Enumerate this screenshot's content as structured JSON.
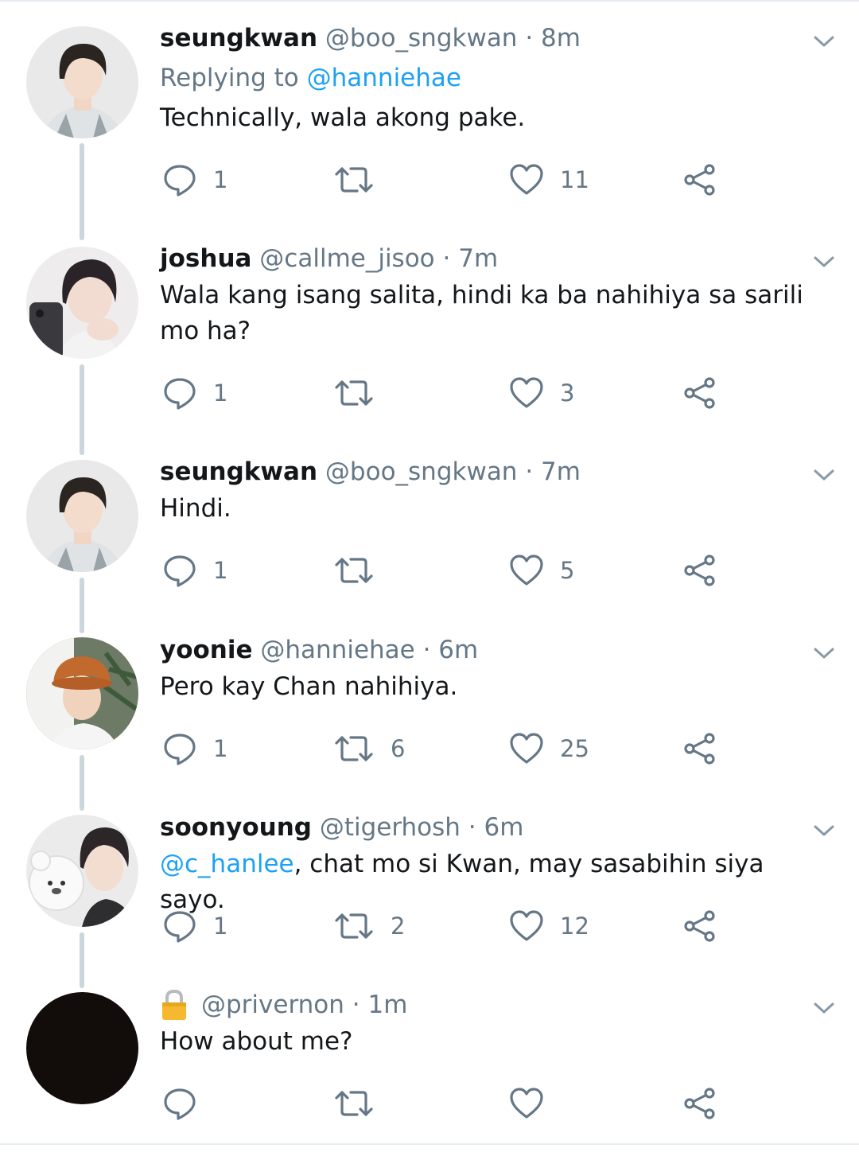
{
  "tweets": [
    {
      "name": "seungkwan",
      "handle": "@boo_sngkwan",
      "separator": "·",
      "time": "8m",
      "replying_prefix": "Replying to ",
      "replying_handle": "@hanniehae",
      "text": "Technically, wala akong pake.",
      "replies": "1",
      "retweets": "",
      "likes": "11",
      "avatar": "seungkwan-avatar"
    },
    {
      "name": "joshua",
      "handle": "@callme_jisoo",
      "separator": "·",
      "time": "7m",
      "text": "Wala kang isang salita, hindi ka ba nahihiya sa sarili mo ha?",
      "replies": "1",
      "retweets": "",
      "likes": "3",
      "avatar": "joshua-avatar"
    },
    {
      "name": "seungkwan",
      "handle": "@boo_sngkwan",
      "separator": "·",
      "time": "7m",
      "text": "Hindi.",
      "replies": "1",
      "retweets": "",
      "likes": "5",
      "avatar": "seungkwan-avatar"
    },
    {
      "name": "yoonie",
      "handle": "@hanniehae",
      "separator": "·",
      "time": "6m",
      "text": "Pero kay Chan nahihiya.",
      "replies": "1",
      "retweets": "6",
      "likes": "25",
      "avatar": "yoonie-avatar"
    },
    {
      "name": "soonyoung",
      "handle": "@tigerhosh",
      "separator": "·",
      "time": "6m",
      "mention": "@c_hanlee",
      "text": ", chat mo si Kwan, may sasabihin siya sayo.",
      "replies": "1",
      "retweets": "2",
      "likes": "12",
      "avatar": "soonyoung-avatar"
    },
    {
      "name": "",
      "handle": "@privernon",
      "separator": "·",
      "time": "1m",
      "text": "How about me?",
      "replies": "",
      "retweets": "",
      "likes": "",
      "avatar": "black-avatar",
      "icon": "lock-icon"
    }
  ],
  "colors": {
    "text": "#14171a",
    "secondary": "#657786",
    "link": "#1da1f2",
    "thread_line": "#ccd6dd"
  }
}
